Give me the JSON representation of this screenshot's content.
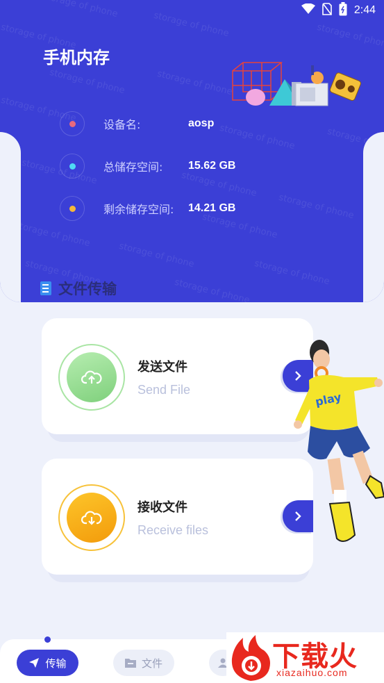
{
  "status_bar": {
    "time": "2:44"
  },
  "header": {
    "title": "手机内存",
    "watermark": "storage of phone",
    "info": [
      {
        "label": "设备名:",
        "value": "aosp",
        "dot_color": "#e8697e"
      },
      {
        "label": "总储存空间:",
        "value": "15.62 GB",
        "dot_color": "#4fd9f4"
      },
      {
        "label": "剩余储存空间:",
        "value": "14.21 GB",
        "dot_color": "#f5b83b"
      }
    ]
  },
  "section": {
    "title": "文件传输"
  },
  "cards": [
    {
      "title": "发送文件",
      "subtitle": "Send File",
      "icon": "cloud-upload-icon",
      "color": "#8fd98b"
    },
    {
      "title": "接收文件",
      "subtitle": "Receive files",
      "icon": "cloud-download-icon",
      "color": "#f8b010"
    }
  ],
  "nav": {
    "tabs": [
      {
        "label": "传输",
        "icon": "send-icon",
        "active": true
      },
      {
        "label": "文件",
        "icon": "folder-icon",
        "active": false
      },
      {
        "label": "",
        "icon": "user-icon",
        "active": false
      }
    ]
  },
  "brand": {
    "logo_text": "下载火",
    "logo_url": "xiazaihuo.com"
  },
  "colors": {
    "primary": "#3b3fd6",
    "background": "#eef1fb"
  }
}
